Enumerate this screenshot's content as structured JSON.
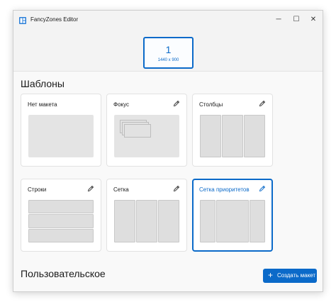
{
  "window": {
    "title": "FancyZones Editor",
    "controls": {
      "minimize": "─",
      "maximize": "☐",
      "close": "✕"
    }
  },
  "monitor": {
    "number": "1",
    "resolution": "1440 x 900"
  },
  "templates_section": {
    "title": "Шаблоны",
    "cards": [
      {
        "label": "Нет макета",
        "preview": "blank",
        "editable": false,
        "selected": false
      },
      {
        "label": "Фокус",
        "preview": "focus",
        "editable": true,
        "selected": false
      },
      {
        "label": "Столбцы",
        "preview": "columns",
        "editable": true,
        "selected": false
      },
      {
        "label": "Строки",
        "preview": "rows",
        "editable": true,
        "selected": false
      },
      {
        "label": "Сетка",
        "preview": "grid",
        "editable": true,
        "selected": false
      },
      {
        "label": "Сетка приоритетов",
        "preview": "priority-grid",
        "editable": true,
        "selected": true
      }
    ]
  },
  "custom_section": {
    "title": "Пользовательское",
    "create_button": {
      "icon": "plus-icon",
      "label": "Создать макет"
    }
  },
  "colors": {
    "accent": "#0b6ac9",
    "zone_fill": "#dedede",
    "zone_border": "#c8c8c8",
    "card_bg": "#ffffff",
    "window_bg": "#f3f3f3"
  }
}
